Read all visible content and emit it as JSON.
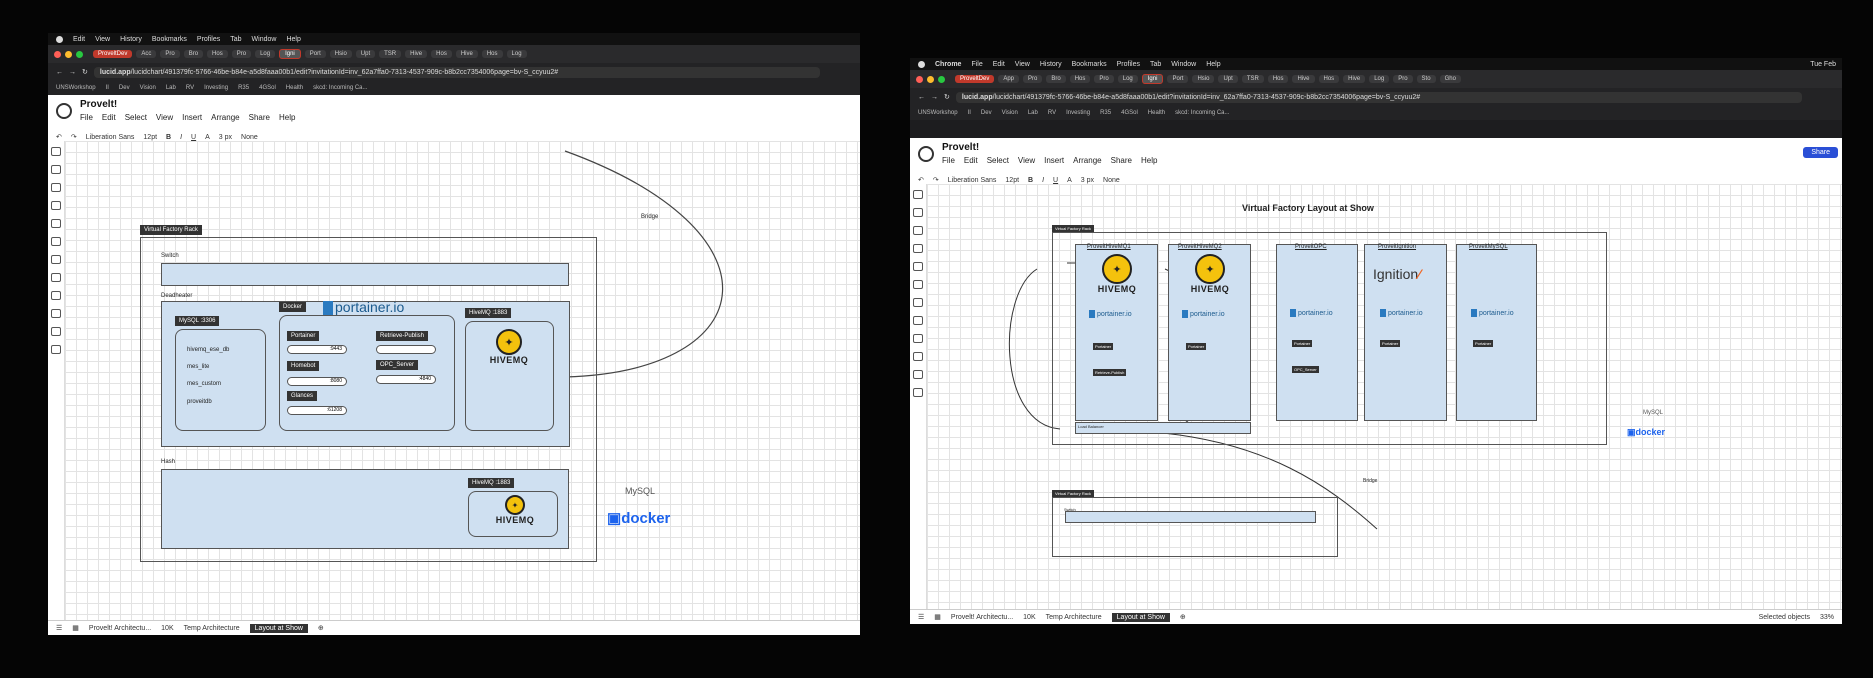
{
  "left": {
    "menubar": [
      "Edit",
      "View",
      "History",
      "Bookmarks",
      "Profiles",
      "Tab",
      "Window",
      "Help"
    ],
    "tabs": [
      "ProveltDev",
      "Acc",
      "Pro",
      "Bro",
      "Hos",
      "Pro",
      "Log",
      "Igni",
      "Port",
      "Hsio",
      "Upt",
      "TSR",
      "Hive",
      "Hos",
      "Hive",
      "Hos",
      "Log"
    ],
    "url_host": "lucid.app",
    "url_path": "/lucidchart/491379fc-5766-46be-b84e-a5d8faaa00b1/edit?invitationId=inv_62a7ffa0-7313-4537-909c-b8b2cc7354006page=bv-S_ccyuu2#",
    "bookmarks": [
      "UNSWorkshop",
      "II",
      "Dev",
      "Vision",
      "Lab",
      "RV",
      "Investing",
      "R35",
      "4GSol",
      "Health",
      "skcd: Incoming Ca..."
    ],
    "doc_title": "Provelt!",
    "app_menu": [
      "File",
      "Edit",
      "Select",
      "View",
      "Insert",
      "Arrange",
      "Share",
      "Help"
    ],
    "toolbar": {
      "font": "Liberation Sans",
      "size": "12pt",
      "bold": "B",
      "italic": "I",
      "underline": "U",
      "color": "A",
      "stroke": "3 px",
      "arrow": "None"
    },
    "canvas": {
      "rack_label": "Virtual Factory Rack",
      "switch_label": "Switch",
      "deadheater_label": "Deadheater",
      "docker_label": "Docker",
      "portainer_logo": "portainer.io",
      "mysql_label": "MySQL :3306",
      "dbs": [
        "hivemq_ese_db",
        "mes_lite",
        "mes_custom",
        "proveitdb"
      ],
      "services": [
        {
          "name": "Portainer",
          "port": ":9443"
        },
        {
          "name": "Homebot",
          "port": ":8080"
        },
        {
          "name": "Glances",
          "port": ":61208"
        },
        {
          "name": "Retrieve-Publish",
          "port": ""
        },
        {
          "name": "OPC_Server",
          "port": ":4840"
        }
      ],
      "hive1_label": "HiveMQ :1883",
      "hive_word": "HIVEMQ",
      "hash_label": "Hash",
      "hive2_label": "HiveMQ :1883",
      "bridge_label": "Bridge",
      "mysql_logo": "MySQL",
      "docker_logo": "docker"
    },
    "pages": [
      "Provelt! Architectu...",
      "10K",
      "Temp Architecture",
      "Layout at Show"
    ]
  },
  "right": {
    "menubar": [
      "Chrome",
      "File",
      "Edit",
      "View",
      "History",
      "Bookmarks",
      "Profiles",
      "Tab",
      "Window",
      "Help"
    ],
    "clock": "Tue Feb",
    "tabs": [
      "ProveltDev",
      "App",
      "Pro",
      "Bro",
      "Hos",
      "Pro",
      "Log",
      "Igni",
      "Port",
      "Hsio",
      "Upt",
      "TSR",
      "Hos",
      "Hive",
      "Hos",
      "Hive",
      "Log",
      "Pro",
      "Sto",
      "Gho"
    ],
    "url_host": "lucid.app",
    "url_path": "/lucidchart/491379fc-5766-46be-b84e-a5d8faaa00b1/edit?invitationId=inv_62a7ffa0-7313-4537-909c-b8b2cc7354006page=bv-S_ccyuu2#",
    "bookmarks": [
      "UNSWorkshop",
      "II",
      "Dev",
      "Vision",
      "Lab",
      "RV",
      "Investing",
      "R35",
      "4GSol",
      "Health",
      "skcd: Incoming Ca..."
    ],
    "doc_title": "Provelt!",
    "app_menu": [
      "File",
      "Edit",
      "Select",
      "View",
      "Insert",
      "Arrange",
      "Share",
      "Help"
    ],
    "share": "Share",
    "toolbar": {
      "font": "Liberation Sans",
      "size": "12pt",
      "bold": "B",
      "italic": "I",
      "underline": "U",
      "color": "A",
      "stroke": "3 px",
      "arrow": "None"
    },
    "canvas": {
      "title": "Virtual Factory Layout at Show",
      "rack_label": "Virtual Factory Rack",
      "columns": [
        "ProveitHiveMQ1",
        "ProveitHiveMQ2",
        "ProveitOPC",
        "ProveitIgnition",
        "ProveitMySQL"
      ],
      "hive_word": "HIVEMQ",
      "portainer_logo": "portainer.io",
      "ignition_logo": "Ignition",
      "pill_portainer": "Portainer",
      "pill_retrieve": "Retrieve-Publish",
      "pill_opc": "OPC_Server",
      "load_balancer": "Load Balancer",
      "bridge_label": "Bridge",
      "rack2_label": "Virtual Factory Rack",
      "switch_label": "Switch",
      "mysql_logo": "MySQL",
      "docker_logo": "docker"
    },
    "pages": [
      "Provelt! Architectu...",
      "10K",
      "Temp Architecture",
      "Layout at Show"
    ],
    "status": "Selected objects",
    "zoom": "33%"
  }
}
